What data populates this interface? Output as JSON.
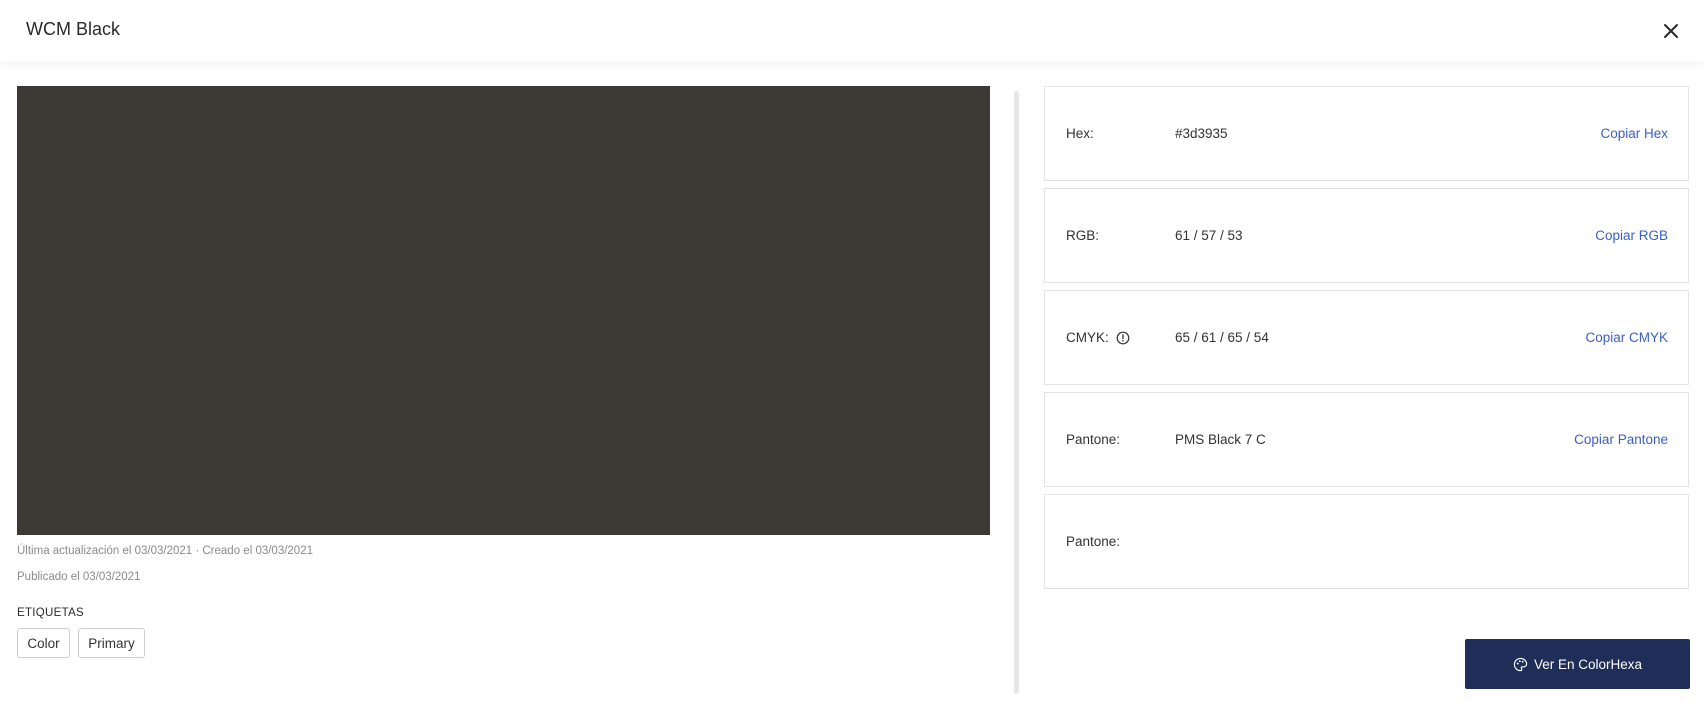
{
  "header": {
    "title": "WCM Black"
  },
  "swatch": {
    "color": "#3d3935"
  },
  "meta": {
    "updated": "Última actualización el 03/03/2021 · Creado el 03/03/2021",
    "published": "Publicado el 03/03/2021"
  },
  "tags": {
    "heading": "ETIQUETAS",
    "items": [
      "Color",
      "Primary"
    ]
  },
  "values": [
    {
      "label": "Hex:",
      "value": "#3d3935",
      "copy": "Copiar Hex"
    },
    {
      "label": "RGB:",
      "value": "61 / 57 / 53",
      "copy": "Copiar RGB"
    },
    {
      "label": "CMYK:",
      "value": "65 / 61 / 65 / 54",
      "copy": "Copiar CMYK"
    },
    {
      "label": "Pantone:",
      "value": "PMS Black 7 C",
      "copy": "Copiar Pantone"
    },
    {
      "label": "Pantone:",
      "value": "",
      "copy": ""
    }
  ],
  "cta": {
    "label": "Ver En ColorHexa"
  },
  "icons": {
    "close": "close-icon",
    "info": "info-icon",
    "palette": "palette-icon"
  },
  "colors": {
    "link": "#3a5fc8",
    "button": "#1f2d59"
  }
}
